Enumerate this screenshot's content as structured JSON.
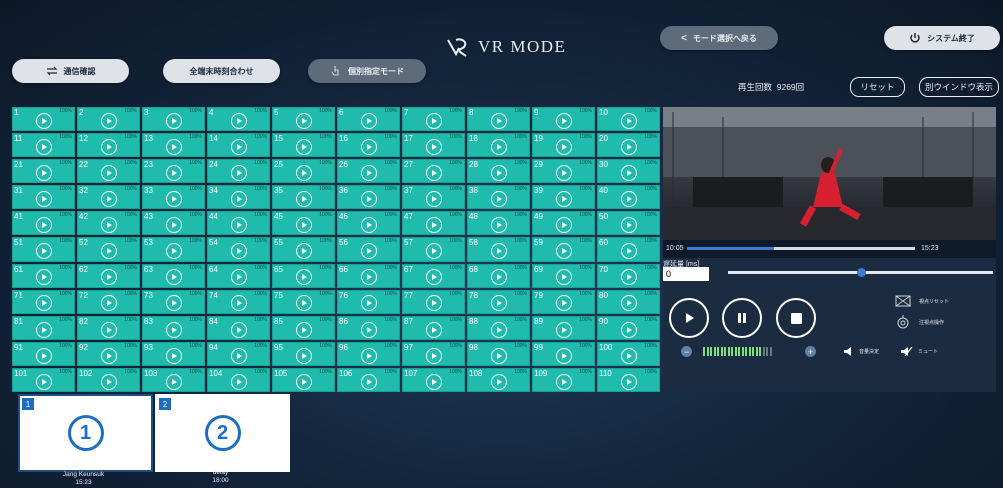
{
  "header": {
    "logo_text": "VR MODE",
    "back_label": "モード選択へ戻る",
    "shutdown_label": "システム終了"
  },
  "toolbar": {
    "comm_label": "通信確認",
    "time_sync_label": "全端末時刻合わせ",
    "individual_label": "個別指定モード"
  },
  "stats": {
    "play_count_label": "再生回数",
    "play_count_value": "9269回",
    "reset_label": "リセット",
    "separate_window_label": "別ウインドウ表示"
  },
  "grid": {
    "cell_percent": "100%",
    "numbers": [
      "1",
      "2",
      "3",
      "4",
      "5",
      "6",
      "7",
      "8",
      "9",
      "10",
      "11",
      "12",
      "13",
      "14",
      "15",
      "16",
      "17",
      "18",
      "19",
      "20",
      "21",
      "22",
      "23",
      "24",
      "25",
      "26",
      "27",
      "28",
      "29",
      "30",
      "31",
      "32",
      "33",
      "34",
      "35",
      "36",
      "37",
      "38",
      "39",
      "40",
      "41",
      "42",
      "43",
      "44",
      "45",
      "46",
      "47",
      "48",
      "49",
      "50",
      "51",
      "52",
      "53",
      "54",
      "55",
      "56",
      "57",
      "58",
      "59",
      "60",
      "61",
      "62",
      "63",
      "64",
      "65",
      "66",
      "67",
      "68",
      "69",
      "70",
      "71",
      "72",
      "73",
      "74",
      "75",
      "76",
      "77",
      "78",
      "79",
      "80",
      "81",
      "82",
      "83",
      "84",
      "85",
      "86",
      "87",
      "88",
      "89",
      "90",
      "91",
      "92",
      "93",
      "94",
      "95",
      "96",
      "97",
      "98",
      "99",
      "100",
      "101",
      "102",
      "103",
      "104",
      "105",
      "106",
      "107",
      "108",
      "109",
      "110"
    ]
  },
  "player": {
    "time_current": "10:05",
    "time_total": "15:23",
    "progress": 0.38,
    "delay_label": "遅延量 [ms]",
    "delay_value": "0",
    "delay_slider": 0.5,
    "reset_view_label": "視点リセット",
    "gaze_label": "注視点操作",
    "volume_set_label": "音量決定",
    "mute_label": "ミュート",
    "volume_level": 0.85
  },
  "thumbnails": [
    {
      "badge": "1",
      "mark": "1",
      "title": "Jang Keunsuk",
      "time": "15:23"
    },
    {
      "badge": "2",
      "mark": "2",
      "title": "delay",
      "time": "18:00"
    }
  ]
}
